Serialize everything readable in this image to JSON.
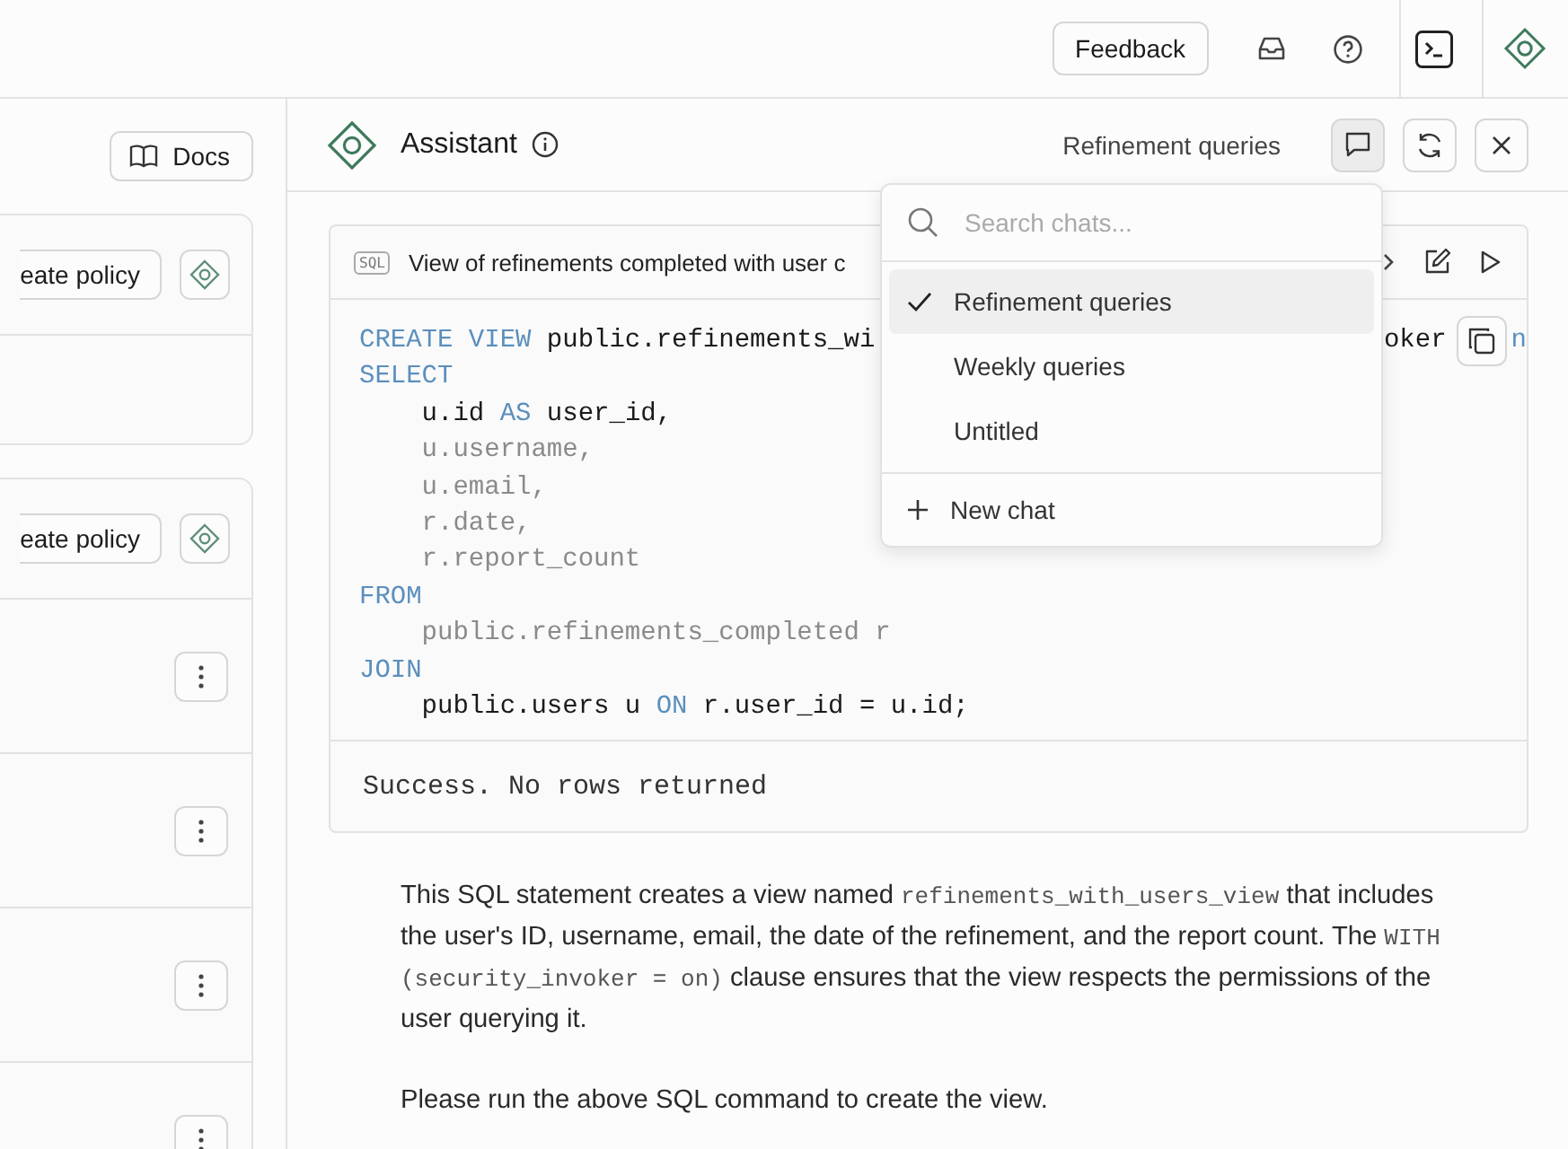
{
  "topbar": {
    "feedback": "Feedback"
  },
  "left_panel": {
    "docs": "Docs",
    "cards": [
      {
        "policy_button": "eate policy"
      },
      {
        "policy_button": "eate policy"
      }
    ]
  },
  "assistant": {
    "title": "Assistant",
    "chat_name": "Refinement queries",
    "sql_card": {
      "badge": "SQL",
      "title": "View of refinements completed with user c",
      "first_line": [
        {
          "text": "CREATE VIEW",
          "kind": "kw"
        },
        {
          "text": " public.refinements_wi",
          "kind": "plain"
        }
      ],
      "first_line_tail": "oker",
      "first_line_end": "n",
      "lines": [
        [
          {
            "text": "SELECT",
            "kind": "kw"
          }
        ],
        [
          {
            "text": "    u.id ",
            "kind": "plain"
          },
          {
            "text": "AS",
            "kind": "kw"
          },
          {
            "text": " user_id,",
            "kind": "plain"
          }
        ],
        [
          {
            "text": "    u.username,",
            "kind": "dim"
          }
        ],
        [
          {
            "text": "    u.email,",
            "kind": "dim"
          }
        ],
        [
          {
            "text": "    r.date,",
            "kind": "dim"
          }
        ],
        [
          {
            "text": "    r.report_count",
            "kind": "dim"
          }
        ],
        [
          {
            "text": "FROM",
            "kind": "kw"
          }
        ],
        [
          {
            "text": "    public.refinements_completed r",
            "kind": "dim"
          }
        ],
        [
          {
            "text": "JOIN",
            "kind": "kw"
          }
        ],
        [
          {
            "text": "    public.users u ",
            "kind": "plain"
          },
          {
            "text": "ON",
            "kind": "kw"
          },
          {
            "text": " r.user_id = u.id;",
            "kind": "plain"
          }
        ]
      ],
      "result": "Success. No rows returned"
    },
    "paragraphs": [
      [
        {
          "text": "This SQL statement creates a view named ",
          "kind": "text"
        },
        {
          "text": "refinements_with_users_view",
          "kind": "code"
        },
        {
          "text": " that includes the user's ID, username, email, the date of the refinement, and the report count. The ",
          "kind": "text"
        },
        {
          "text": "WITH (security_invoker = on)",
          "kind": "code"
        },
        {
          "text": " clause ensures that the view respects the permissions of the user querying it.",
          "kind": "text"
        }
      ],
      [
        {
          "text": "Please run the above SQL command to create the view.",
          "kind": "text"
        }
      ]
    ]
  },
  "chat_menu": {
    "search": {
      "placeholder": "Search chats..."
    },
    "items": [
      {
        "label": "Refinement queries",
        "selected": true
      },
      {
        "label": "Weekly queries",
        "selected": false
      },
      {
        "label": "Untitled",
        "selected": false
      }
    ],
    "new_chat": "New chat"
  }
}
